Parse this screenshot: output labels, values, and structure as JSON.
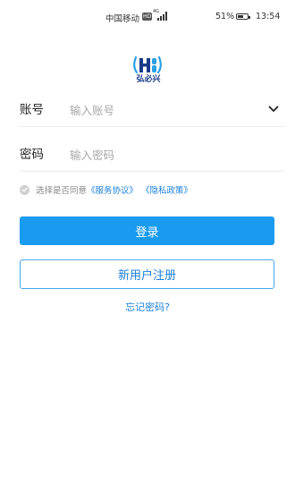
{
  "status_bar": {
    "carrier": "中国移动",
    "network_badge": "HD",
    "signal_label": "4G",
    "battery": "51%",
    "battery_level": 0.51,
    "time": "13:54"
  },
  "logo": {
    "app_name": "弘必兴",
    "icon": "hbx-logo-icon",
    "colors": {
      "dark": "#1a3a8a",
      "accent": "#2aa0e8"
    }
  },
  "form": {
    "account_label": "账号",
    "account_placeholder": "输入账号",
    "account_value": "",
    "password_label": "密码",
    "password_placeholder": "输入密码",
    "password_value": "",
    "dropdown_icon": "chevron-down-icon"
  },
  "agreement": {
    "prefix": "选择是否同意",
    "service_link": "《服务协议》",
    "privacy_link": "《隐私政策》",
    "checked": false
  },
  "actions": {
    "login_label": "登录",
    "register_label": "新用户注册",
    "forgot_label": "忘记密码?"
  },
  "colors": {
    "primary": "#1a9bf0",
    "link": "#1a7fd9",
    "placeholder": "#a8a8a8"
  }
}
